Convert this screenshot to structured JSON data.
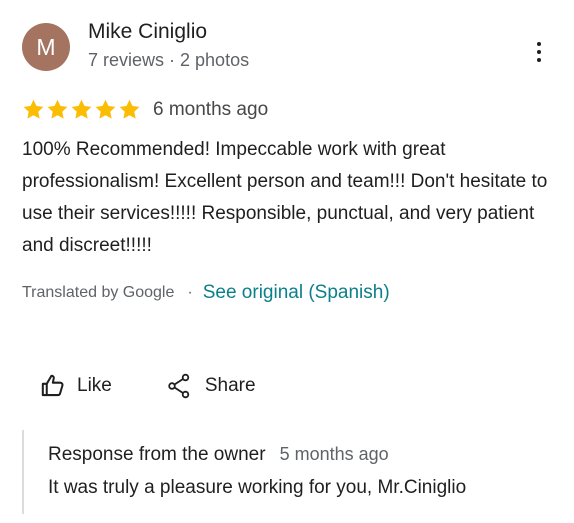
{
  "author": {
    "initial": "M",
    "name": "Mike Ciniglio",
    "meta": "7 reviews · 2 photos",
    "avatar_color": "#a47461"
  },
  "review": {
    "stars": 5,
    "max_stars": 5,
    "star_color": "#fbbc04",
    "time": "6 months ago",
    "text": "100% Recommended! Impeccable work with great professionalism! Excellent person and team!!! Don't hesitate to use their services!!!!! Responsible, punctual, and very patient and discreet!!!!!"
  },
  "translation": {
    "translated_by": "Translated by Google",
    "separator": "·",
    "see_original": "See original (Spanish)",
    "link_color": "#0b7f8a"
  },
  "actions": {
    "like_label": "Like",
    "like_icon": "thumbs-up-icon",
    "share_label": "Share",
    "share_icon": "share-icon",
    "more_icon": "more-vert-icon"
  },
  "owner_response": {
    "title": "Response from the owner",
    "time": "5 months ago",
    "text": "It was truly a pleasure working for you, Mr.Ciniglio"
  }
}
